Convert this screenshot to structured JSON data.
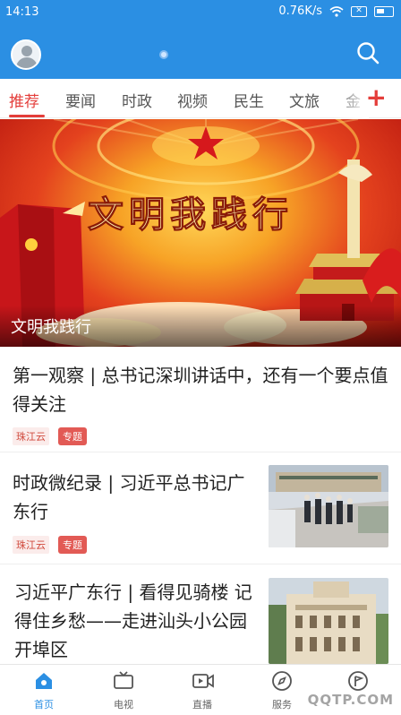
{
  "status_bar": {
    "time": "14:13",
    "speed": "0.76K/s",
    "icons": [
      "wifi-icon",
      "no-sim-icon",
      "battery-icon"
    ]
  },
  "header": {
    "avatar": "avatar-icon",
    "search_icon": "search-icon",
    "accent_color": "#2b8fe3"
  },
  "tabs": [
    {
      "label": "推荐",
      "active": true
    },
    {
      "label": "要闻"
    },
    {
      "label": "时政"
    },
    {
      "label": "视频"
    },
    {
      "label": "民生"
    },
    {
      "label": "文旅"
    },
    {
      "label": "金"
    }
  ],
  "tab_add_label": "+",
  "banner": {
    "art_text": "文明我践行",
    "caption": "文明我践行"
  },
  "articles": [
    {
      "title": "第一观察 | 总书记深圳讲话中，还有一个要点值得关注",
      "source": "珠江云",
      "tag": "专题"
    },
    {
      "title": "时政微纪录 | 习近平总书记广东行",
      "source": "珠江云",
      "tag": "专题"
    },
    {
      "title": "习近平广东行 | 看得见骑楼 记得住乡愁——走进汕头小公园开埠区"
    }
  ],
  "bottom_nav": [
    {
      "label": "首页",
      "icon": "home-icon",
      "active": true
    },
    {
      "label": "电视",
      "icon": "tv-icon"
    },
    {
      "label": "直播",
      "icon": "live-icon"
    },
    {
      "label": "服务",
      "icon": "compass-icon"
    },
    {
      "label": "",
      "icon": "flag-icon"
    }
  ],
  "watermark": "QQTP.COM",
  "colors": {
    "red": "#e43d3a",
    "blue": "#2b8fe3"
  }
}
